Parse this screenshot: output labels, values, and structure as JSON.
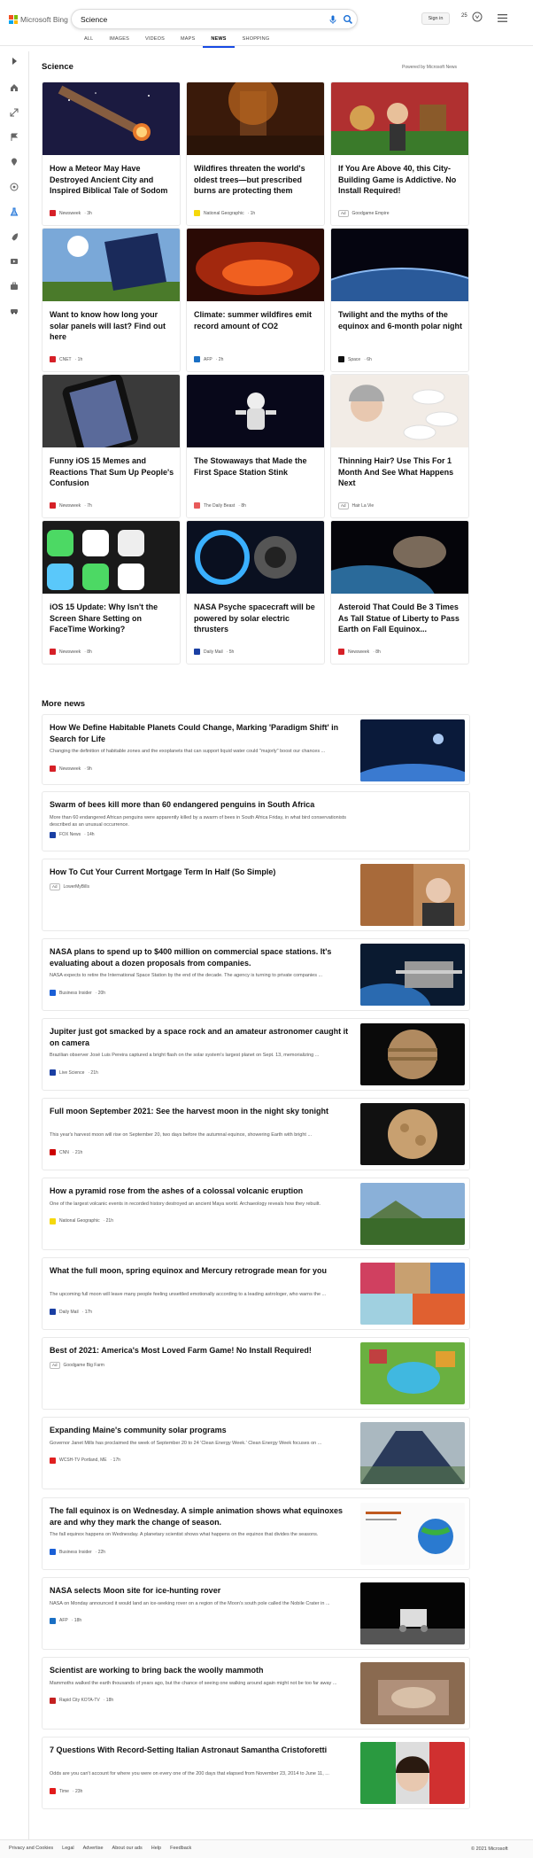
{
  "brand": {
    "name": "Microsoft Bing"
  },
  "search": {
    "query": "Science"
  },
  "tabs": [
    "ALL",
    "IMAGES",
    "VIDEOS",
    "MAPS",
    "NEWS",
    "SHOPPING"
  ],
  "active_tab": "NEWS",
  "header": {
    "signin": "Sign in",
    "rewards": "25"
  },
  "section": {
    "title": "Science",
    "powered": "Powered by Microsoft News"
  },
  "cards": [
    {
      "title": "How a Meteor May Have Destroyed Ancient City and Inspired Biblical Tale of Sodom",
      "source": "Newsweek",
      "age": "3h",
      "fav_color": "#d62027",
      "icon": "meteor-image"
    },
    {
      "title": "Wildfires threaten the world's oldest trees—but prescribed burns are protecting them",
      "source": "National Geographic",
      "age": "1h",
      "fav_color": "#f5d80c",
      "icon": "forest-fire-image"
    },
    {
      "title": "If You Are Above 40, this City-Building Game is Addictive. No Install Required!",
      "source": "Goodgame Empire",
      "age": "",
      "ad": "Ad",
      "fav_color": "",
      "icon": "game-image"
    },
    {
      "title": "Want to know how long your solar panels will last? Find out here",
      "source": "CNET",
      "age": "1h",
      "fav_color": "#d62027",
      "icon": "solar-panel-image"
    },
    {
      "title": "Climate: summer wildfires emit record amount of CO2",
      "source": "AFP",
      "age": "2h",
      "fav_color": "#1a6fc4",
      "icon": "wildfire-image"
    },
    {
      "title": "Twilight and the myths of the equinox and 6-month polar night",
      "source": "Space",
      "age": "6h",
      "fav_color": "#111111",
      "icon": "earth-image"
    },
    {
      "title": "Funny iOS 15 Memes and Reactions That Sum Up People's Confusion",
      "source": "Newsweek",
      "age": "7h",
      "fav_color": "#d62027",
      "icon": "phone-image"
    },
    {
      "title": "The Stowaways that Made the First Space Station Stink",
      "source": "The Daily Beast",
      "age": "8h",
      "fav_color": "#e85a5a",
      "icon": "astronaut-image"
    },
    {
      "title": "Thinning Hair? Use This For 1 Month And See What Happens Next",
      "source": "Hair La Vie",
      "age": "",
      "ad": "Ad",
      "fav_color": "",
      "icon": "woman-pills-image"
    },
    {
      "title": "iOS 15 Update: Why Isn't the Screen Share Setting on FaceTime Working?",
      "source": "Newsweek",
      "age": "8h",
      "fav_color": "#d62027",
      "icon": "ios-apps-image"
    },
    {
      "title": "NASA Psyche spacecraft will be powered by solar electric thrusters",
      "source": "Daily Mail",
      "age": "5h",
      "fav_color": "#1a3fa3",
      "icon": "thruster-image"
    },
    {
      "title": "Asteroid That Could Be 3 Times As Tall Statue of Liberty to Pass Earth on Fall Equinox...",
      "source": "Newsweek",
      "age": "8h",
      "fav_color": "#d62027",
      "icon": "asteroid-image"
    }
  ],
  "more_news": {
    "title": "More news"
  },
  "rows": [
    {
      "title": "How We Define Habitable Planets Could Change, Marking 'Paradigm Shift' in Search for Life",
      "snippet": "Changing the definition of habitable zones and the exoplanets that can support liquid water could \"majorly\" boost our chances ...",
      "source": "Newsweek",
      "age": "9h",
      "fav_color": "#d62027",
      "icon": "planet-image"
    },
    {
      "title": "Swarm of bees kill more than 60 endangered penguins in South Africa",
      "snippet": "More than 60 endangered African penguins were apparently killed by a swarm of bees in South Africa Friday, in what bird conservationists described as an unusual occurrence.",
      "source": "FOX News",
      "age": "14h",
      "fav_color": "#1a3fa3",
      "icon": ""
    },
    {
      "title": "How To Cut Your Current Mortgage Term In Half (So Simple)",
      "snippet": "",
      "source": "LowerMyBills",
      "age": "",
      "ad": "Ad",
      "fav_color": "",
      "icon": "mortgage-image"
    },
    {
      "title": "NASA plans to spend up to $400 million on commercial space stations. It's evaluating about a dozen proposals from companies.",
      "snippet": "NASA expects to retire the International Space Station by the end of the decade. The agency is turning to private companies ...",
      "source": "Business Insider",
      "age": "20h",
      "fav_color": "#1a5fd6",
      "icon": "space-station-image"
    },
    {
      "title": "Jupiter just got smacked by a space rock and an amateur astronomer caught it on camera",
      "snippet": "Brazilian observer José Luis Pereira captured a bright flash on the solar system's largest planet on Sept. 13, memorializing ...",
      "source": "Live Science",
      "age": "21h",
      "fav_color": "#1a3fa3",
      "icon": "jupiter-image"
    },
    {
      "title": "Full moon September 2021: See the harvest moon in the night sky tonight",
      "snippet": "This year's harvest moon will rise on September 20, two days before the autumnal equinox, showering Earth with bright ...",
      "source": "CNN",
      "age": "21h",
      "fav_color": "#cc0000",
      "icon": "moon-image"
    },
    {
      "title": "How a pyramid rose from the ashes of a colossal volcanic eruption",
      "snippet": "One of the largest volcanic events in recorded history destroyed an ancient Maya world. Archaeology reveals how they rebuilt.",
      "source": "National Geographic",
      "age": "21h",
      "fav_color": "#f5d80c",
      "icon": "pyramid-image"
    },
    {
      "title": "What the full moon, spring equinox and Mercury retrograde mean for you",
      "snippet": "The upcoming full moon will leave many people feeling unsettled emotionally according to a leading astrologer, who warns the ...",
      "source": "Daily Mail",
      "age": "17h",
      "fav_color": "#1a3fa3",
      "icon": "collage-image"
    },
    {
      "title": "Best of 2021: America's Most Loved Farm Game! No Install Required!",
      "snippet": "",
      "source": "Goodgame Big Farm",
      "age": "",
      "ad": "Ad",
      "fav_color": "",
      "icon": "farm-game-image"
    },
    {
      "title": "Expanding Maine's community solar programs",
      "snippet": "Governor Janet Mills has proclaimed the week of September 20 to 24 'Clean Energy Week.' Clean Energy Week focuses on ...",
      "source": "WCSH-TV Portland, ME",
      "age": "17h",
      "fav_color": "#e02020",
      "icon": "solar-farm-image"
    },
    {
      "title": "The fall equinox is on Wednesday. A simple animation shows what equinoxes are and why they mark the change of season.",
      "snippet": "The fall equinox happens on Wednesday. A planetary scientist shows what happens on the equinox that divides the seasons.",
      "source": "Business Insider",
      "age": "22h",
      "fav_color": "#1a5fd6",
      "icon": "equinox-diagram-image"
    },
    {
      "title": "NASA selects Moon site for ice-hunting rover",
      "snippet": "NASA on Monday announced it would land an ice-seeking rover on a region of the Moon's south pole called the Nobile Crater in ...",
      "source": "AFP",
      "age": "18h",
      "fav_color": "#1a6fc4",
      "icon": "rover-image"
    },
    {
      "title": "Scientist are working to bring back the woolly mammoth",
      "snippet": "Mammoths walked the earth thousands of years ago, but the chance of seeing one walking around again might not be too far away ...",
      "source": "Rapid City KOTA-TV",
      "age": "18h",
      "fav_color": "#c42020",
      "icon": "mammoth-image"
    },
    {
      "title": "7 Questions With Record-Setting Italian Astronaut Samantha Cristoforetti",
      "snippet": "Odds are you can't account for where you were on every one of the 200 days that elapsed from November 23, 2014 to June 11, ...",
      "source": "Time",
      "age": "23h",
      "fav_color": "#e21b1b",
      "icon": "astronaut-portrait-image"
    }
  ],
  "footer": {
    "links": [
      "Privacy and Cookies",
      "Legal",
      "Advertise",
      "About our ads",
      "Help",
      "Feedback"
    ],
    "copyright": "© 2021 Microsoft"
  }
}
